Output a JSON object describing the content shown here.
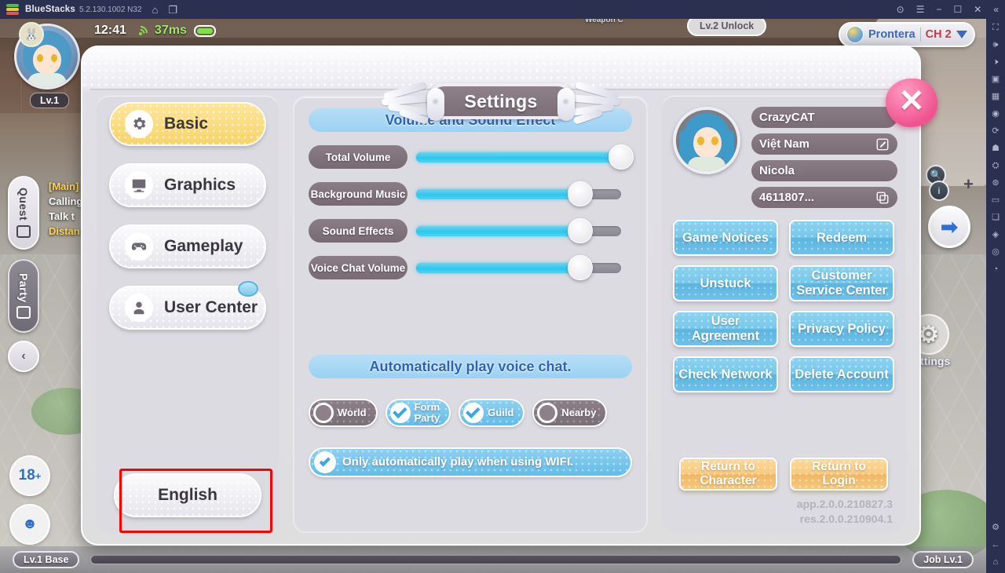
{
  "bluestacks": {
    "app_name": "BlueStacks",
    "version": "5.2.130.1002 N32",
    "titlebar_icons": [
      "home-icon",
      "multi-instance-icon"
    ],
    "window_controls": [
      "help-icon",
      "menu-icon",
      "minimize-icon",
      "maximize-icon",
      "close-icon",
      "collapse-icon"
    ],
    "rail_icons": [
      "fullscreen-icon",
      "volume-up-icon",
      "volume-down-icon",
      "keyboard-mapping-icon",
      "screenshot-icon",
      "video-record-icon",
      "rotate-icon",
      "shake-icon",
      "gamepad-icon",
      "location-icon",
      "folder-icon",
      "copy-icon",
      "eraser-icon",
      "multi-instance-manager-icon",
      "macro-icon",
      "settings-icon",
      "back-icon",
      "home-nav-icon"
    ]
  },
  "hud": {
    "time": "12:41",
    "ping": "37ms",
    "level_badge": "Lv.1",
    "quest_tab": "Quest",
    "party_tab": "Party",
    "quest_lines": [
      "[Main]",
      "Calling",
      "Talk t",
      "Distan"
    ],
    "location": "Prontera",
    "channel": "CH 2",
    "unlock_text": "Lv.2 Unlock",
    "weapon_text": "Weapon C",
    "settings_label": "Settings",
    "rating_badge": "18",
    "rating_sup": "+",
    "bottom_left": "Lv.1  Base",
    "bottom_right": "Job  Lv.1"
  },
  "modal": {
    "title": "Settings",
    "close_label": "✕"
  },
  "sidebar": {
    "items": [
      {
        "label": "Basic",
        "icon": "gear-icon",
        "active": true,
        "badge": false
      },
      {
        "label": "Graphics",
        "icon": "monitor-icon",
        "active": false,
        "badge": false
      },
      {
        "label": "Gameplay",
        "icon": "gamepad-icon",
        "active": false,
        "badge": false
      },
      {
        "label": "User Center",
        "icon": "user-icon",
        "active": false,
        "badge": true
      }
    ],
    "language_button": "English"
  },
  "audio": {
    "section_title": "Volume and Sound Effect",
    "sliders": [
      {
        "label": "Total Volume",
        "value": 100
      },
      {
        "label": "Background Music",
        "value": 80
      },
      {
        "label": "Sound Effects",
        "value": 80
      },
      {
        "label": "Voice Chat Volume",
        "value": 80
      }
    ]
  },
  "voice_chat": {
    "section_title": "Automatically play voice chat.",
    "options": [
      {
        "label": "World",
        "checked": false
      },
      {
        "label": "Form\nParty",
        "checked": true
      },
      {
        "label": "Guild",
        "checked": true
      },
      {
        "label": "Nearby",
        "checked": false
      }
    ],
    "wifi_only": {
      "label": "Only automatically play when using WIFI.",
      "checked": true
    }
  },
  "account": {
    "avatar": "character-portrait",
    "fields": [
      {
        "value": "CrazyCAT",
        "icon": null
      },
      {
        "value": "Việt Nam",
        "icon": "edit-icon"
      },
      {
        "value": "Nicola",
        "icon": null
      },
      {
        "value": "4611807...",
        "icon": "copy-icon"
      }
    ],
    "buttons": [
      "Game Notices",
      "Redeem",
      "Unstuck",
      "Customer\nService Center",
      "User\nAgreement",
      "Privacy Policy",
      "Check Network",
      "Delete Account"
    ],
    "return_buttons": [
      "Return to\nCharacter",
      "Return to\nLogin"
    ],
    "version_app": "app.2.0.0.210827.3",
    "version_res": "res.2.0.0.210904.1"
  },
  "colors": {
    "accent_blue": "#62bde9",
    "accent_yellow": "#f8d368",
    "accent_orange": "#f0b764",
    "highlight_red": "#fe0000",
    "panel_bg": "#dcdbe1",
    "label_gray": "#7a6c75"
  }
}
